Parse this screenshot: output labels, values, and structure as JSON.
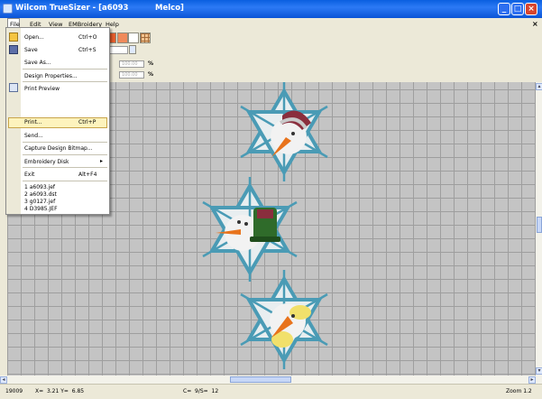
{
  "window": {
    "title": "Wilcom TrueSizer - [a6093          Melco]",
    "doc_close": "×",
    "buttons": {
      "minimize": "_",
      "maximize": "□",
      "close": "×"
    }
  },
  "menubar": {
    "items": [
      "File",
      "Edit",
      "View",
      "EMBroidery",
      "Help"
    ]
  },
  "toolbar": {
    "width_value": "100.00",
    "height_value": "100.00",
    "percent": "%"
  },
  "file_menu": {
    "items": [
      {
        "label": "Open...",
        "shortcut": "Ctrl+O",
        "icon": "folder-open-icon"
      },
      {
        "label": "Save",
        "shortcut": "Ctrl+S",
        "icon": "floppy-disk-icon"
      },
      {
        "label": "Save As...",
        "shortcut": ""
      },
      {
        "label": "Design Properties...",
        "shortcut": ""
      },
      {
        "label": "Print Preview",
        "shortcut": "",
        "icon": "print-preview-icon"
      },
      {
        "label": "Print...",
        "shortcut": "Ctrl+P",
        "highlighted": true
      },
      {
        "label": "Send...",
        "shortcut": ""
      },
      {
        "label": "Capture Design Bitmap...",
        "shortcut": ""
      },
      {
        "label": "Embroidery Disk",
        "shortcut": "▸"
      },
      {
        "label": "Exit",
        "shortcut": "Alt+F4"
      },
      {
        "label": "1 a6093.jef",
        "shortcut": ""
      },
      {
        "label": "2 a6093.dst",
        "shortcut": ""
      },
      {
        "label": "3 g0127.jef",
        "shortcut": ""
      },
      {
        "label": "4 D3985.JEF",
        "shortcut": ""
      }
    ]
  },
  "statusbar": {
    "stitch_count": "19009",
    "coords": "X=  3.21 Y=  6.85",
    "colors": "C=  9/S=  12",
    "zoom": "Zoom 1.2"
  },
  "colors": {
    "title_bar": "#0a5fe0",
    "menu_highlight": "#fdf3bd",
    "canvas_grid": "#c4c4c4",
    "snowflake": "#4a9bb5",
    "hat_green": "#2f6b2a",
    "hat_red": "#8a2e3d",
    "carrot": "#e8731c"
  }
}
